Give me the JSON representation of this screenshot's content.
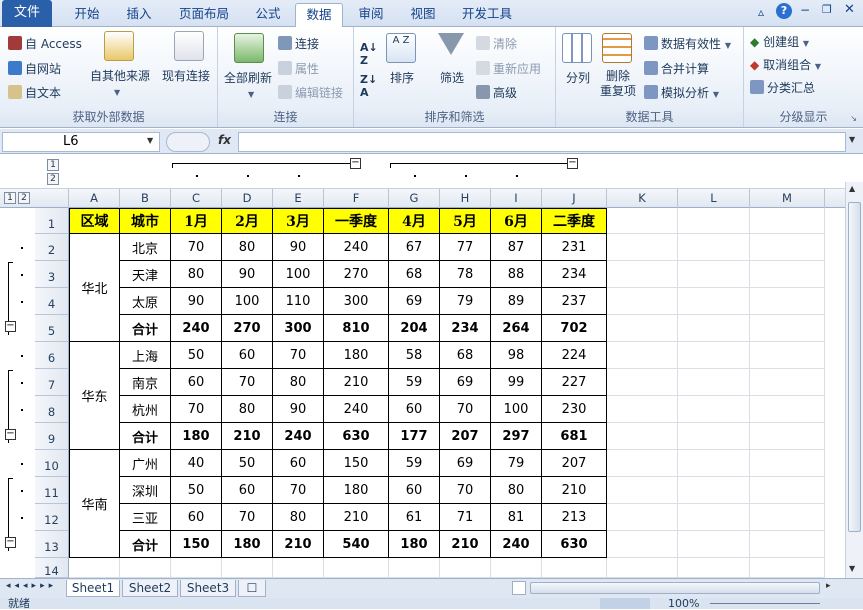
{
  "tabs": [
    "文件",
    "开始",
    "插入",
    "页面布局",
    "公式",
    "数据",
    "审阅",
    "视图",
    "开发工具"
  ],
  "ribbon": {
    "get_external": {
      "access": "自 Access",
      "web": "自网站",
      "text": "自文本",
      "other": "自其他来源",
      "existing": "现有连接",
      "label": "获取外部数据"
    },
    "connections": {
      "refresh": "全部刷新",
      "connections": "连接",
      "properties": "属性",
      "edit_links": "编辑链接",
      "label": "连接"
    },
    "sort_filter": {
      "sort_asc": "A↓Z",
      "sort": "排序",
      "filter": "筛选",
      "clear": "清除",
      "reapply": "重新应用",
      "advanced": "高级",
      "label": "排序和筛选"
    },
    "data_tools": {
      "text_to_cols": "分列",
      "remove_dup": "删除\n重复项",
      "validation": "数据有效性",
      "consolidate": "合并计算",
      "whatif": "模拟分析",
      "label": "数据工具"
    },
    "outline": {
      "group": "创建组",
      "ungroup": "取消组合",
      "subtotal": "分类汇总",
      "label": "分级显示"
    }
  },
  "formula_bar": {
    "name_box": "L6",
    "fx": "fx",
    "formula": ""
  },
  "outline_levels": [
    "1",
    "2"
  ],
  "columns": [
    "A",
    "B",
    "C",
    "D",
    "E",
    "F",
    "G",
    "H",
    "I",
    "J",
    "K",
    "L",
    "M"
  ],
  "rows": [
    "1",
    "2",
    "3",
    "4",
    "5",
    "6",
    "7",
    "8",
    "9",
    "10",
    "11",
    "12",
    "13",
    "14"
  ],
  "table": {
    "headers": [
      "区域",
      "城市",
      "1月",
      "2月",
      "3月",
      "一季度",
      "4月",
      "5月",
      "6月",
      "二季度"
    ],
    "regions": [
      "华北",
      "华东",
      "华南"
    ],
    "data": [
      [
        "北京",
        "70",
        "80",
        "90",
        "240",
        "67",
        "77",
        "87",
        "231"
      ],
      [
        "天津",
        "80",
        "90",
        "100",
        "270",
        "68",
        "78",
        "88",
        "234"
      ],
      [
        "太原",
        "90",
        "100",
        "110",
        "300",
        "69",
        "79",
        "89",
        "237"
      ],
      [
        "合计",
        "240",
        "270",
        "300",
        "810",
        "204",
        "234",
        "264",
        "702"
      ],
      [
        "上海",
        "50",
        "60",
        "70",
        "180",
        "58",
        "68",
        "98",
        "224"
      ],
      [
        "南京",
        "60",
        "70",
        "80",
        "210",
        "59",
        "69",
        "99",
        "227"
      ],
      [
        "杭州",
        "70",
        "80",
        "90",
        "240",
        "60",
        "70",
        "100",
        "230"
      ],
      [
        "合计",
        "180",
        "210",
        "240",
        "630",
        "177",
        "207",
        "297",
        "681"
      ],
      [
        "广州",
        "40",
        "50",
        "60",
        "150",
        "59",
        "69",
        "79",
        "207"
      ],
      [
        "深圳",
        "50",
        "60",
        "70",
        "180",
        "60",
        "70",
        "80",
        "210"
      ],
      [
        "三亚",
        "60",
        "70",
        "80",
        "210",
        "61",
        "71",
        "81",
        "213"
      ],
      [
        "合计",
        "150",
        "180",
        "210",
        "540",
        "180",
        "210",
        "240",
        "630"
      ]
    ]
  },
  "sheets": [
    "Sheet1",
    "Sheet2",
    "Sheet3"
  ],
  "status": {
    "ready": "就绪",
    "zoom": "100%"
  }
}
